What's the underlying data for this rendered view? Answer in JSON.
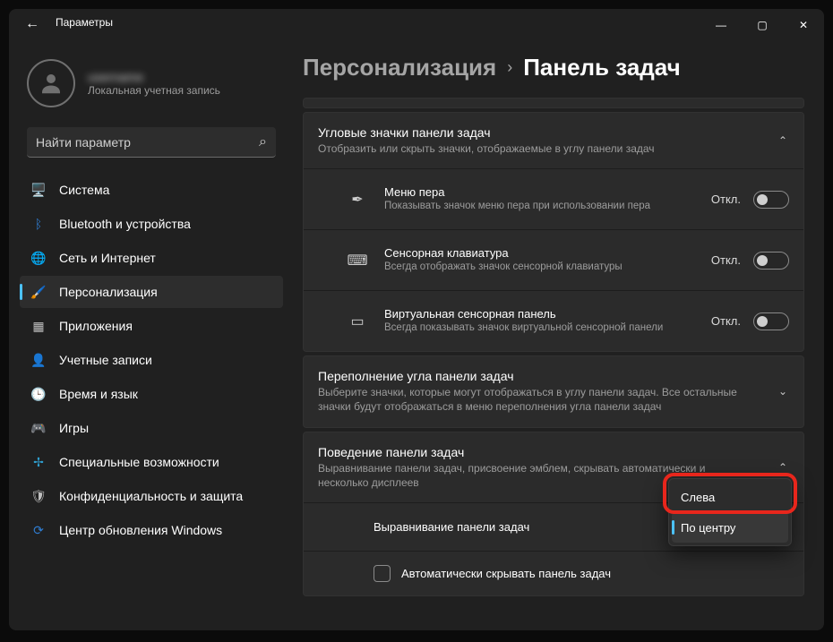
{
  "titlebar": {
    "title": "Параметры"
  },
  "user": {
    "name": "username",
    "sub": "Локальная учетная запись"
  },
  "search": {
    "placeholder": "Найти параметр"
  },
  "nav": {
    "items": [
      {
        "label": "Система",
        "icon": "🖥️",
        "color": "#2f7cd0"
      },
      {
        "label": "Bluetooth и устройства",
        "icon": "ᛒ",
        "color": "#2f7cd0"
      },
      {
        "label": "Сеть и Интернет",
        "icon": "🌐",
        "color": "#2f9fd0"
      },
      {
        "label": "Персонализация",
        "icon": "🖌️",
        "color": "#d08c2f"
      },
      {
        "label": "Приложения",
        "icon": "▦",
        "color": "#bfbfbf"
      },
      {
        "label": "Учетные записи",
        "icon": "👤",
        "color": "#2fae6e"
      },
      {
        "label": "Время и язык",
        "icon": "🕒",
        "color": "#2f7cd0"
      },
      {
        "label": "Игры",
        "icon": "🎮",
        "color": "#bfbfbf"
      },
      {
        "label": "Специальные возможности",
        "icon": "✢",
        "color": "#2f9fd0"
      },
      {
        "label": "Конфиденциальность и защита",
        "icon": "🛡",
        "color": "#bfbfbf"
      },
      {
        "label": "Центр обновления Windows",
        "icon": "⟳",
        "color": "#2f7cd0"
      }
    ],
    "active_index": 3
  },
  "breadcrumb": {
    "parent": "Персонализация",
    "current": "Панель задач"
  },
  "section_corner": {
    "title": "Угловые значки панели задач",
    "subtitle": "Отобразить или скрыть значки, отображаемые в углу панели задач",
    "rows": [
      {
        "icon": "✒",
        "title": "Меню пера",
        "sub": "Показывать значок меню пера при использовании пера",
        "state": "Откл."
      },
      {
        "icon": "⌨",
        "title": "Сенсорная клавиатура",
        "sub": "Всегда отображать значок сенсорной клавиатуры",
        "state": "Откл."
      },
      {
        "icon": "▭",
        "title": "Виртуальная сенсорная панель",
        "sub": "Всегда показывать значок виртуальной сенсорной панели",
        "state": "Откл."
      }
    ]
  },
  "section_overflow": {
    "title": "Переполнение угла панели задач",
    "subtitle": "Выберите значки, которые могут отображаться в углу панели задач. Все остальные значки будут отображаться в меню переполнения угла панели задач"
  },
  "section_behavior": {
    "title": "Поведение панели задач",
    "subtitle": "Выравнивание панели задач, присвоение эмблем, скрывать автоматически и несколько дисплеев",
    "align_label": "Выравнивание панели задач",
    "align_value": "По центру",
    "autohide": "Автоматически скрывать панель задач"
  },
  "popup": {
    "opt_left": "Слева",
    "opt_center": "По центру"
  }
}
